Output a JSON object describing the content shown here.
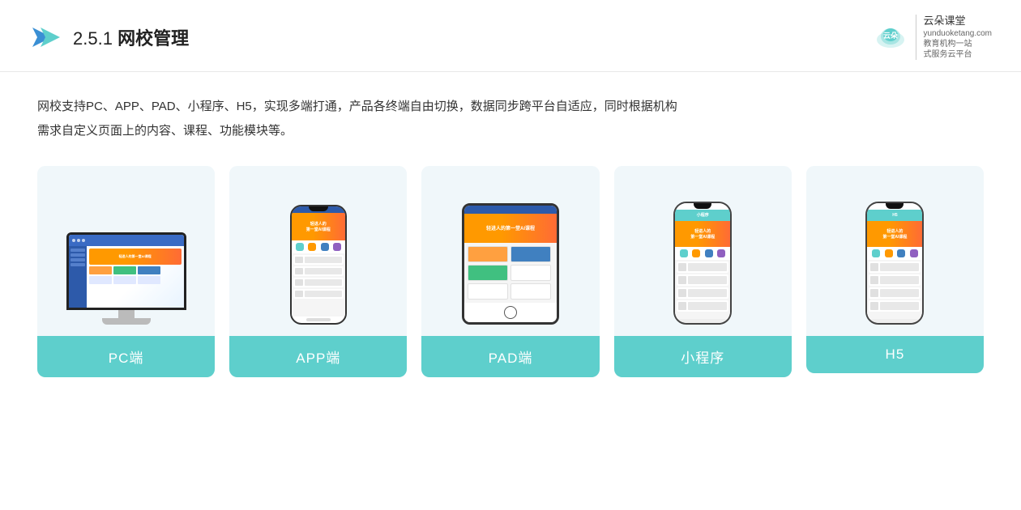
{
  "header": {
    "section_num": "2.5.1",
    "title_bold": "网校管理",
    "brand": {
      "logo_text": "云朵课堂",
      "logo_sub1": "教育机构一站",
      "logo_sub2": "式服务云平台",
      "domain": "yunduoketang.com"
    }
  },
  "description": {
    "line1": "网校支持PC、APP、PAD、小程序、H5，实现多端打通，产品各终端自由切换，数据同步跨平台自适应，同时根据机构",
    "line2": "需求自定义页面上的内容、课程、功能模块等。"
  },
  "cards": [
    {
      "id": "pc",
      "label": "PC端",
      "device": "pc"
    },
    {
      "id": "app",
      "label": "APP端",
      "device": "phone"
    },
    {
      "id": "pad",
      "label": "PAD端",
      "device": "pad"
    },
    {
      "id": "mini",
      "label": "小程序",
      "device": "miniphone"
    },
    {
      "id": "h5",
      "label": "H5",
      "device": "miniphone2"
    }
  ],
  "colors": {
    "accent": "#5ecfcc",
    "orange": "#f90",
    "bg_card": "#f0f7fa"
  }
}
